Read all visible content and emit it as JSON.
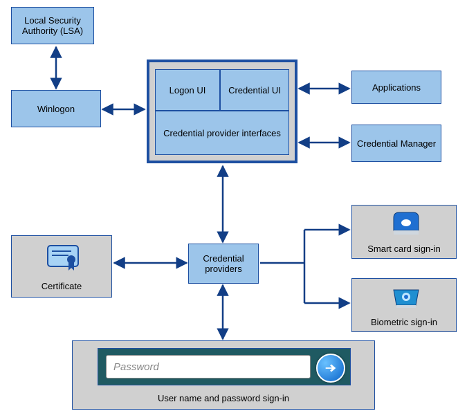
{
  "boxes": {
    "lsa": "Local Security Authority (LSA)",
    "winlogon": "Winlogon",
    "logonui": "Logon UI",
    "credui": "Credential UI",
    "credprovif": "Credential provider interfaces",
    "applications": "Applications",
    "credmanager": "Credential Manager",
    "credproviders": "Credential providers"
  },
  "panels": {
    "certificate": "Certificate",
    "smartcard": "Smart card sign-in",
    "biometric": "Biometric sign-in",
    "userpassword": "User name and password sign-in"
  },
  "passwordField": {
    "placeholder": "Password"
  }
}
